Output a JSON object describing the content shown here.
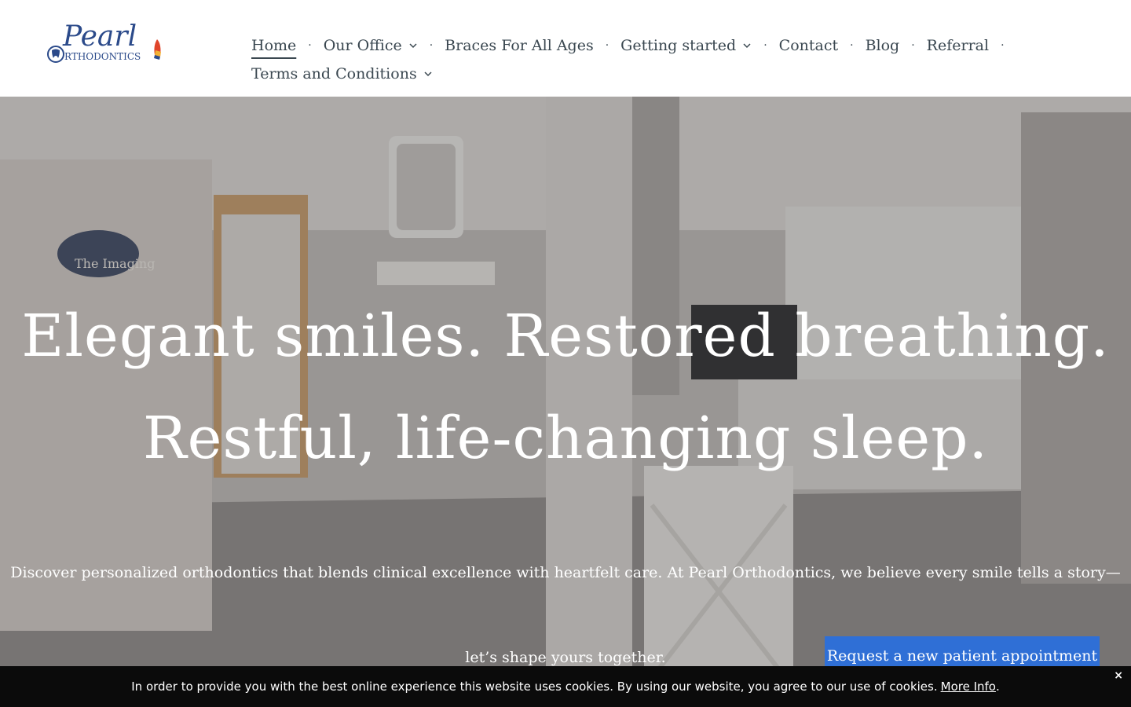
{
  "logo": {
    "name": "Pearl",
    "subname": "RTHODONTICS",
    "icon": "tooth-logo-icon"
  },
  "nav": {
    "items": [
      {
        "label": "Home",
        "active": true,
        "dropdown": false
      },
      {
        "label": "Our Office",
        "active": false,
        "dropdown": true
      },
      {
        "label": "Braces For All Ages",
        "active": false,
        "dropdown": false
      },
      {
        "label": "Getting started",
        "active": false,
        "dropdown": true
      },
      {
        "label": "Contact",
        "active": false,
        "dropdown": false
      },
      {
        "label": "Blog",
        "active": false,
        "dropdown": false
      },
      {
        "label": "Referral",
        "active": false,
        "dropdown": false
      },
      {
        "label": "Terms and Conditions",
        "active": false,
        "dropdown": true
      }
    ],
    "separator": "·"
  },
  "hero": {
    "headline_1": "Elegant smiles. Restored breathing.",
    "headline_2": "Restful, life-changing sleep.",
    "description": "Discover personalized orthodontics that blends clinical excellence with heartfelt care. At Pearl Orthodontics, we believe every smile tells a story—let’s shape yours together.",
    "sign_imaging": "The Imaging"
  },
  "cta": {
    "label": "Request a new patient appointment",
    "color": "#2f6fd6"
  },
  "cookie": {
    "text": "In order to provide you with the best online experience this website uses cookies. By using our website, you agree to our use of cookies.",
    "link": "More Info",
    "close": "×"
  },
  "colors": {
    "nav_text": "#3a4750",
    "logo_blue": "#2b4a8a",
    "cookie_bg": "#0b0b0b"
  }
}
